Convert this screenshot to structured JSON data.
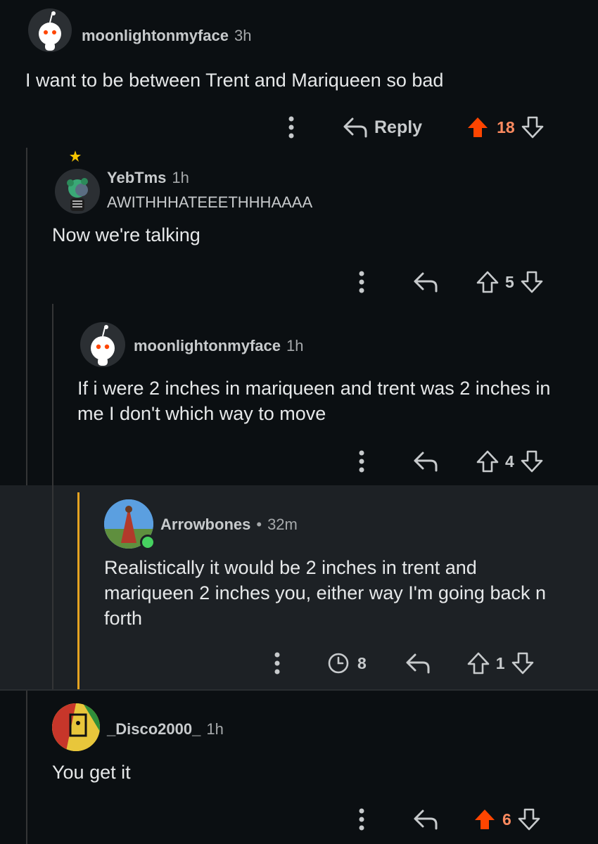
{
  "comments": [
    {
      "username": "moonlightonmyface",
      "time": "3h",
      "body": "I want to be between Trent and Mariqueen so bad",
      "votes": "18",
      "reply_label": "Reply"
    },
    {
      "username": "YebTms",
      "time": "1h",
      "flair": "AWITHHHATEEETHHHAAAA",
      "body": "Now we're talking",
      "votes": "5"
    },
    {
      "username": "moonlightonmyface",
      "time": "1h",
      "body": "If i were 2 inches in mariqueen and trent was 2 inches in me I don't which way to move",
      "votes": "4"
    },
    {
      "username": "Arrowbones",
      "time": "32m",
      "separator": "•",
      "body": "Realistically it would be 2 inches in trent and mariqueen 2 inches you, either way I'm going back n forth",
      "votes": "1",
      "awards": "8"
    },
    {
      "username": "_Disco2000_",
      "time": "1h",
      "body": "You get it",
      "votes": "6"
    }
  ],
  "colors": {
    "background": "#0b0f12",
    "highlight": "#1d2125",
    "upvote_active": "#ff4500",
    "vote_count_active": "#ff8b60",
    "thread_line": "#343536",
    "indicator": "#e5a321",
    "online": "#46d160"
  },
  "icons": {
    "more": "more-vertical-icon",
    "reply": "reply-arrow-icon",
    "upvote": "upvote-arrow-icon",
    "downvote": "downvote-arrow-icon",
    "award": "award-clock-icon"
  }
}
